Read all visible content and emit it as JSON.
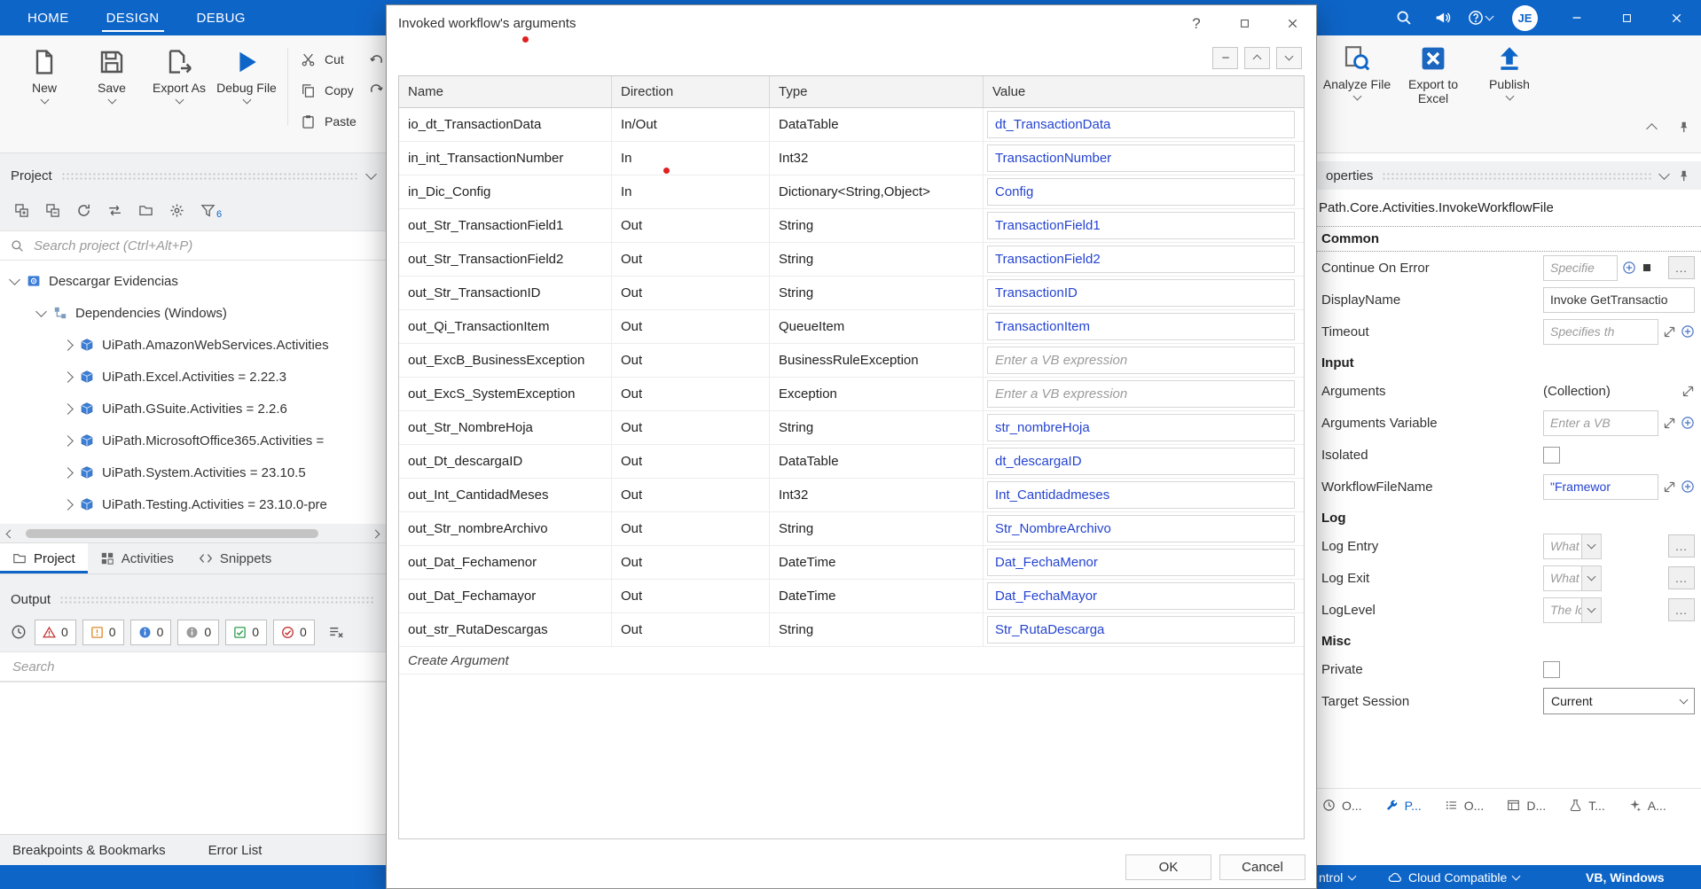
{
  "ribbon": {
    "tabs": [
      "HOME",
      "DESIGN",
      "DEBUG"
    ],
    "active_tab": "DESIGN",
    "avatar_initials": "JE"
  },
  "toolbar": {
    "new": "New",
    "save": "Save",
    "export_as": "Export As",
    "debug_file": "Debug File",
    "cut": "Cut",
    "copy": "Copy",
    "paste": "Paste",
    "analyze_file": "Analyze File",
    "export_to_excel": "Export to Excel",
    "publish": "Publish"
  },
  "project_panel": {
    "title": "Project",
    "filter_badge": "6",
    "search_placeholder": "Search project (Ctrl+Alt+P)",
    "tree": [
      {
        "label": "Descargar Evidencias",
        "level": 0,
        "chevron": "down",
        "icon": "project"
      },
      {
        "label": "Dependencies (Windows)",
        "level": 1,
        "chevron": "down",
        "icon": "dependencies"
      },
      {
        "label": "UiPath.AmazonWebServices.Activities",
        "level": 2,
        "chevron": "right",
        "icon": "package"
      },
      {
        "label": "UiPath.Excel.Activities = 2.22.3",
        "level": 2,
        "chevron": "right",
        "icon": "package"
      },
      {
        "label": "UiPath.GSuite.Activities = 2.2.6",
        "level": 2,
        "chevron": "right",
        "icon": "package"
      },
      {
        "label": "UiPath.MicrosoftOffice365.Activities =",
        "level": 2,
        "chevron": "right",
        "icon": "package"
      },
      {
        "label": "UiPath.System.Activities = 23.10.5",
        "level": 2,
        "chevron": "right",
        "icon": "package"
      },
      {
        "label": "UiPath.Testing.Activities = 23.10.0-pre",
        "level": 2,
        "chevron": "right",
        "icon": "package"
      }
    ],
    "tabs": [
      {
        "label": "Project",
        "active": true
      },
      {
        "label": "Activities",
        "active": false
      },
      {
        "label": "Snippets",
        "active": false
      }
    ]
  },
  "output_panel": {
    "title": "Output",
    "counters": [
      {
        "kind": "error",
        "count": "0"
      },
      {
        "kind": "warning",
        "count": "0"
      },
      {
        "kind": "info",
        "count": "0"
      },
      {
        "kind": "trace",
        "count": "0"
      },
      {
        "kind": "success",
        "count": "0"
      },
      {
        "kind": "failed",
        "count": "0"
      }
    ],
    "search_placeholder": "Search"
  },
  "bottom_left_panels": [
    "Breakpoints & Bookmarks",
    "Error List"
  ],
  "dialog": {
    "title": "Invoked workflow's arguments",
    "help_glyph": "?",
    "columns": [
      "Name",
      "Direction",
      "Type",
      "Value"
    ],
    "rows": [
      {
        "name": "io_dt_TransactionData",
        "direction": "In/Out",
        "type": "DataTable",
        "value": "dt_TransactionData",
        "is_placeholder": false
      },
      {
        "name": "in_int_TransactionNumber",
        "direction": "In",
        "type": "Int32",
        "value": "TransactionNumber",
        "is_placeholder": false
      },
      {
        "name": "in_Dic_Config",
        "direction": "In",
        "type": "Dictionary<String,Object>",
        "value": "Config",
        "is_placeholder": false
      },
      {
        "name": "out_Str_TransactionField1",
        "direction": "Out",
        "type": "String",
        "value": "TransactionField1",
        "is_placeholder": false
      },
      {
        "name": "out_Str_TransactionField2",
        "direction": "Out",
        "type": "String",
        "value": "TransactionField2",
        "is_placeholder": false
      },
      {
        "name": "out_Str_TransactionID",
        "direction": "Out",
        "type": "String",
        "value": "TransactionID",
        "is_placeholder": false
      },
      {
        "name": "out_Qi_TransactionItem",
        "direction": "Out",
        "type": "QueueItem",
        "value": "TransactionItem",
        "is_placeholder": false
      },
      {
        "name": "out_ExcB_BusinessException",
        "direction": "Out",
        "type": "BusinessRuleException",
        "value": "Enter a VB expression",
        "is_placeholder": true
      },
      {
        "name": "out_ExcS_SystemException",
        "direction": "Out",
        "type": "Exception",
        "value": "Enter a VB expression",
        "is_placeholder": true
      },
      {
        "name": "out_Str_NombreHoja",
        "direction": "Out",
        "type": "String",
        "value": "str_nombreHoja",
        "is_placeholder": false
      },
      {
        "name": "out_Dt_descargaID",
        "direction": "Out",
        "type": "DataTable",
        "value": "dt_descargaID",
        "is_placeholder": false
      },
      {
        "name": "out_Int_CantidadMeses",
        "direction": "Out",
        "type": "Int32",
        "value": "Int_Cantidadmeses",
        "is_placeholder": false
      },
      {
        "name": "out_Str_nombreArchivo",
        "direction": "Out",
        "type": "String",
        "value": "Str_NombreArchivo",
        "is_placeholder": false
      },
      {
        "name": "out_Dat_Fechamenor",
        "direction": "Out",
        "type": "DateTime",
        "value": "Dat_FechaMenor",
        "is_placeholder": false
      },
      {
        "name": "out_Dat_Fechamayor",
        "direction": "Out",
        "type": "DateTime",
        "value": "Dat_FechaMayor",
        "is_placeholder": false
      },
      {
        "name": "out_str_RutaDescargas",
        "direction": "Out",
        "type": "String",
        "value": "Str_RutaDescarga",
        "is_placeholder": false
      }
    ],
    "create_argument": "Create Argument",
    "ok": "OK",
    "cancel": "Cancel"
  },
  "properties": {
    "title": "operties",
    "activity_type": "Path.Core.Activities.InvokeWorkflowFile",
    "ellipsis": "...",
    "sections": [
      {
        "title": "Common",
        "rows": [
          {
            "label": "Continue On Error",
            "value": "Specifie",
            "is_placeholder": true,
            "is_expression": false,
            "widget": "input-plus-square-dots"
          },
          {
            "label": "DisplayName",
            "value": "Invoke GetTransactio",
            "is_placeholder": false,
            "is_expression": false,
            "widget": "input"
          },
          {
            "label": "Timeout",
            "value": "Specifies th",
            "is_placeholder": true,
            "is_expression": false,
            "widget": "input-expand-plus"
          }
        ]
      },
      {
        "title": "Input",
        "rows": [
          {
            "label": "Arguments",
            "value": "(Collection)",
            "is_placeholder": false,
            "is_expression": false,
            "widget": "text-expand"
          },
          {
            "label": "Arguments Variable",
            "value": "Enter a VB",
            "is_placeholder": true,
            "is_expression": false,
            "widget": "input-expand-plus"
          },
          {
            "label": "Isolated",
            "value": "",
            "is_placeholder": false,
            "is_expression": false,
            "widget": "checkbox"
          },
          {
            "label": "WorkflowFileName",
            "value": "\"Framewor",
            "is_placeholder": false,
            "is_expression": true,
            "widget": "input-expand-plus"
          }
        ]
      },
      {
        "title": "Log",
        "rows": [
          {
            "label": "Log Entry",
            "value": "What type o",
            "is_placeholder": true,
            "is_expression": false,
            "widget": "dropdown-dots"
          },
          {
            "label": "Log Exit",
            "value": "What type o",
            "is_placeholder": true,
            "is_expression": false,
            "widget": "dropdown-dots"
          },
          {
            "label": "LogLevel",
            "value": "The logging",
            "is_placeholder": true,
            "is_expression": false,
            "widget": "dropdown-dots"
          }
        ]
      },
      {
        "title": "Misc",
        "rows": [
          {
            "label": "Private",
            "value": "",
            "is_placeholder": false,
            "is_expression": false,
            "widget": "checkbox"
          },
          {
            "label": "Target Session",
            "value": "Current",
            "is_placeholder": false,
            "is_expression": false,
            "widget": "select"
          }
        ]
      }
    ],
    "dock_tabs": [
      {
        "label": "O...",
        "icon": "clock",
        "active": false
      },
      {
        "label": "P...",
        "icon": "wrench",
        "active": true
      },
      {
        "label": "O...",
        "icon": "list",
        "active": false
      },
      {
        "label": "D...",
        "icon": "window",
        "active": false
      },
      {
        "label": "T...",
        "icon": "flask",
        "active": false
      },
      {
        "label": "A...",
        "icon": "sparkle",
        "active": false
      }
    ]
  },
  "status_bar": {
    "left": "ntrol",
    "cloud": "Cloud Compatible",
    "lang": "VB, Windows"
  }
}
